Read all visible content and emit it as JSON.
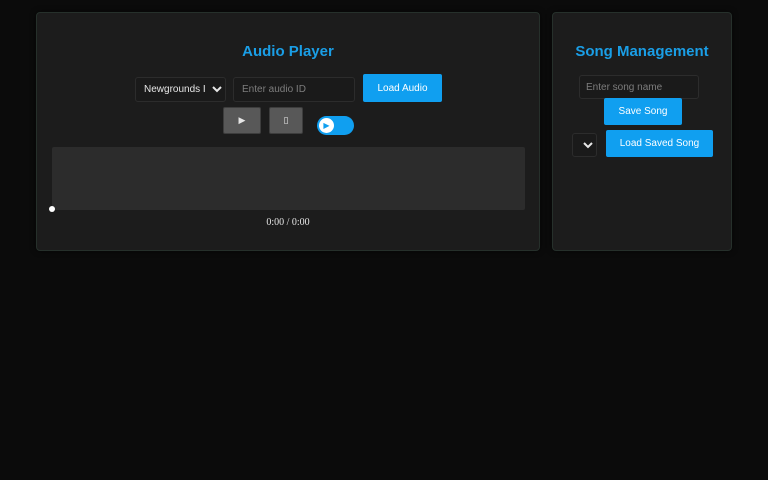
{
  "player": {
    "title": "Audio Player",
    "source_options": [
      "Newgrounds ID"
    ],
    "source_selected": "Newgrounds ID",
    "audio_id_value": "",
    "audio_id_placeholder": "Enter audio ID",
    "load_label": "Load Audio",
    "play_symbol": "▶",
    "stop_symbol": "▯",
    "toggle_symbol": "▶",
    "toggle_on": true,
    "time": "0:00 / 0:00",
    "progress": 0
  },
  "management": {
    "title": "Song Management",
    "song_name_value": "",
    "song_name_placeholder": "Enter song name",
    "save_label": "Save Song",
    "saved_selected": "",
    "load_saved_label": "Load Saved Song"
  },
  "colors": {
    "accent": "#109ff0",
    "title": "#1a9ee6",
    "background": "#0b0b0b",
    "panel": "#1c1c1c"
  }
}
